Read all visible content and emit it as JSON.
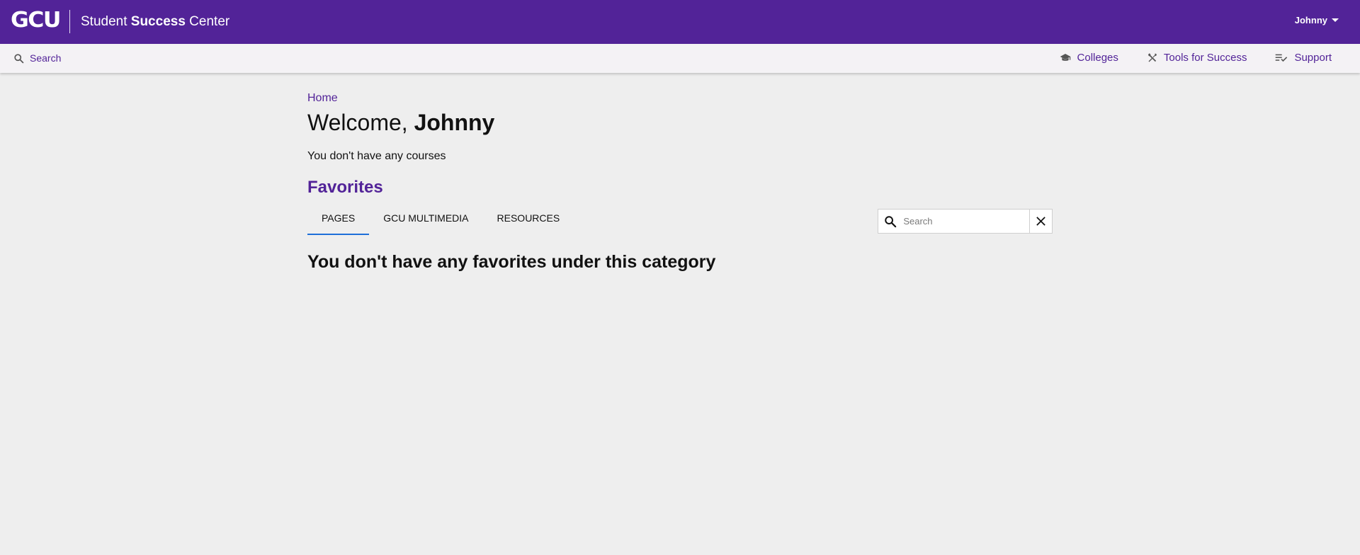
{
  "header": {
    "logo_text": "GCU",
    "title_prefix": "Student ",
    "title_bold": "Success",
    "title_suffix": " Center",
    "user_name": "Johnny",
    "background_color": "#522398"
  },
  "subnav": {
    "search_label": "Search",
    "links": [
      {
        "label": "Colleges",
        "icon": "graduation-cap-icon"
      },
      {
        "label": "Tools for Success",
        "icon": "tools-icon"
      },
      {
        "label": "Support",
        "icon": "checklist-icon"
      }
    ]
  },
  "main": {
    "breadcrumb": "Home",
    "welcome_prefix": "Welcome, ",
    "welcome_name": "Johnny",
    "no_courses": "You don't have any courses",
    "favorites_title": "Favorites",
    "tabs": [
      {
        "label": "PAGES",
        "active": true
      },
      {
        "label": "GCU MULTIMEDIA",
        "active": false
      },
      {
        "label": "RESOURCES",
        "active": false
      }
    ],
    "search": {
      "placeholder": "Search",
      "value": ""
    },
    "empty_message": "You don't have any favorites under this category"
  },
  "colors": {
    "brand_purple": "#522398",
    "active_tab_underline": "#1e6fd9",
    "page_background": "#eeeeee"
  }
}
